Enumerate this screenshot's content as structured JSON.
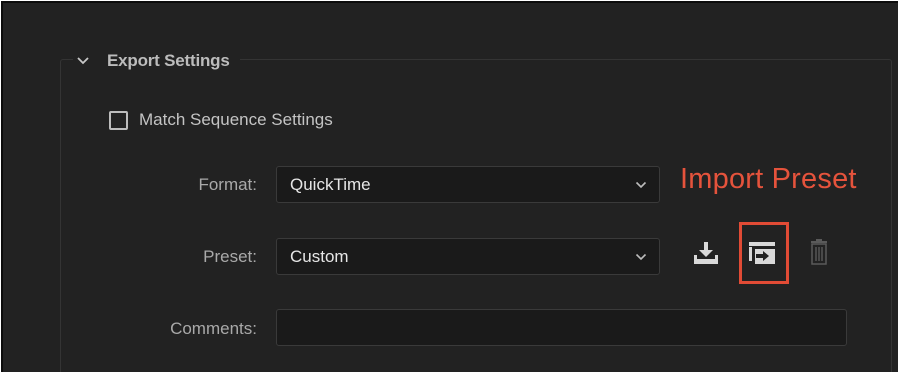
{
  "export_settings": {
    "section_title": "Export Settings",
    "match_sequence_label": "Match Sequence Settings",
    "match_sequence_checked": false,
    "format": {
      "label": "Format:",
      "value": "QuickTime"
    },
    "preset": {
      "label": "Preset:",
      "value": "Custom"
    },
    "comments": {
      "label": "Comments:",
      "value": ""
    }
  },
  "preset_actions": {
    "save_icon": "save-preset-icon",
    "import_icon": "import-preset-icon",
    "delete_icon": "trash-icon"
  },
  "annotation": {
    "text": "Import Preset",
    "color": "#e5533c"
  }
}
